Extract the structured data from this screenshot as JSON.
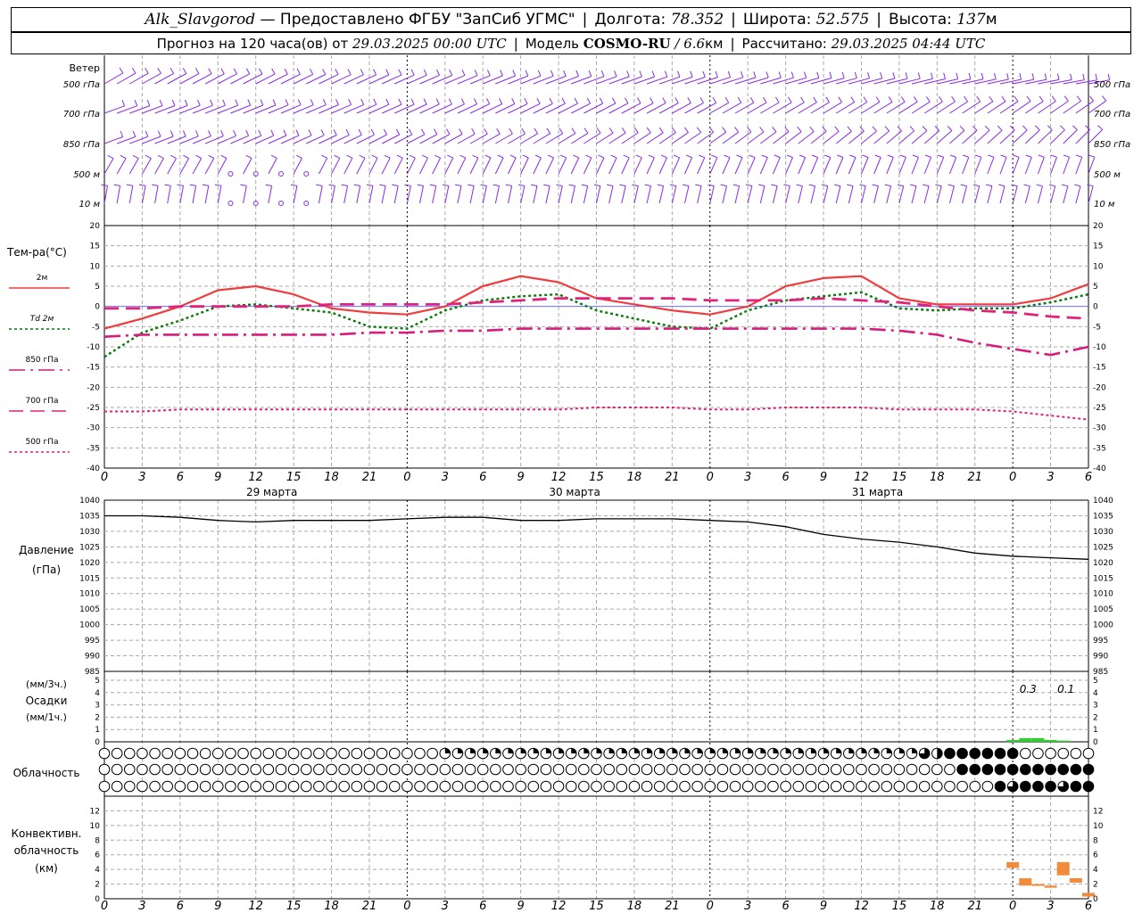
{
  "header": {
    "station": "Alk_Slavgorod",
    "dash": "—",
    "provider": "Предоставлено ФГБУ \"ЗапСиб УГМС\"",
    "lon_label": "Долгота:",
    "lon_value": "78.352",
    "lat_label": "Широта:",
    "lat_value": "52.575",
    "alt_label": "Высота:",
    "alt_value": "137",
    "alt_unit": "м"
  },
  "subheader": {
    "forecast_prefix": "Прогноз на 120 часа(ов) от",
    "forecast_from": "29.03.2025 00:00 UTC",
    "model_label": "Модель",
    "model_name": "COSMO-RU",
    "model_res": "/ 6.6",
    "model_res_unit": "км",
    "computed_label": "Рассчитано:",
    "computed_value": "29.03.2025 04:44 UTC"
  },
  "wind_panel": {
    "title": "Ветер",
    "levels_left": [
      "500 гПа",
      "700 гПа",
      "850 гПа",
      "500 м",
      "10  м"
    ],
    "levels_right": [
      "500 гПа",
      "700 гПа",
      "850 гПа",
      "500 м",
      "10  м"
    ],
    "color": "#8a2be2"
  },
  "temp_panel": {
    "title": "Тем-ра(°С)",
    "legend": [
      {
        "label": "2м",
        "color": "#f03c3c",
        "dash": ""
      },
      {
        "label": "Td  2м",
        "color": "#0a7a0a",
        "dash": "3,3"
      },
      {
        "label": "850 гПа",
        "color": "#d61c7c",
        "dash": "18,6,3,6"
      },
      {
        "label": "700 гПа",
        "color": "#e0227a",
        "dash": "16,8"
      },
      {
        "label": "500 гПа",
        "color": "#e0227a",
        "dash": "3,3"
      }
    ]
  },
  "pressure_panel": {
    "title": "Давление",
    "unit": "(гПа)"
  },
  "precip_panel": {
    "unit1": "(мм/3ч.)",
    "title": "Осадки",
    "unit2": "(мм/1ч.)",
    "labels": [
      "0.3",
      "0.1"
    ]
  },
  "cloud_panel": {
    "title": "Облачность"
  },
  "conv_panel": {
    "title1": "Конвективн.",
    "title2": "облачность",
    "unit": "(км)"
  },
  "time_axis": {
    "ticks": [
      "0",
      "3",
      "6",
      "9",
      "12",
      "15",
      "18",
      "21",
      "0",
      "3",
      "6",
      "9",
      "12",
      "15",
      "18",
      "21",
      "0",
      "3",
      "6",
      "9",
      "12",
      "15",
      "18",
      "21",
      "0",
      "3",
      "6"
    ],
    "dates": [
      "29 марта",
      "30 марта",
      "31 марта"
    ]
  },
  "chart_data": [
    {
      "type": "line",
      "name": "temperature",
      "ylabel": "Тем-ра(°С)",
      "ylim": [
        -40,
        20
      ],
      "yticks": [
        20,
        15,
        10,
        5,
        0,
        -5,
        -10,
        -15,
        -20,
        -25,
        -30,
        -35,
        -40
      ],
      "x_hours": [
        0,
        3,
        6,
        9,
        12,
        15,
        18,
        21,
        24,
        27,
        30,
        33,
        36,
        39,
        42,
        45,
        48,
        51,
        54,
        57,
        60,
        63,
        66,
        69,
        72,
        75,
        78
      ],
      "series": [
        {
          "name": "2м",
          "color": "#f03c3c",
          "values": [
            -5.5,
            -3,
            0,
            4,
            5,
            3,
            -0.5,
            -1.5,
            -2,
            0,
            5,
            7.5,
            6,
            2,
            0.5,
            -1,
            -2,
            0,
            5,
            7,
            7.5,
            2,
            0.5,
            0.5,
            0.5,
            2,
            5.5
          ]
        },
        {
          "name": "Td 2м",
          "color": "#0a7a0a",
          "values": [
            -12.5,
            -6.5,
            -3.5,
            0,
            0.5,
            -0.5,
            -1.5,
            -5,
            -5.5,
            -1,
            1.5,
            2.5,
            3,
            -1,
            -3,
            -5,
            -5.5,
            -1,
            1.5,
            2.5,
            3.5,
            -0.5,
            -1,
            -0.5,
            -0.5,
            1,
            3
          ]
        },
        {
          "name": "850 гПа",
          "color": "#d61c7c",
          "values": [
            -7.5,
            -7,
            -7,
            -7,
            -7,
            -7,
            -7,
            -6.5,
            -6.5,
            -6,
            -6,
            -5.5,
            -5.5,
            -5.5,
            -5.5,
            -5.5,
            -5.5,
            -5.5,
            -5.5,
            -5.5,
            -5.5,
            -6,
            -7,
            -9,
            -10.5,
            -12,
            -10
          ]
        },
        {
          "name": "700 гПа",
          "color": "#e0227a",
          "values": [
            -0.5,
            -0.5,
            0,
            0,
            0,
            0,
            0.5,
            0.5,
            0.5,
            0.5,
            1,
            1.5,
            2,
            2,
            2,
            2,
            1.5,
            1.5,
            1.5,
            2,
            1.5,
            1,
            0,
            -1,
            -1.5,
            -2.5,
            -3
          ]
        },
        {
          "name": "500 гПа",
          "color": "#e0227a",
          "values": [
            -26,
            -26,
            -25.5,
            -25.5,
            -25.5,
            -25.5,
            -25.5,
            -25.5,
            -25.5,
            -25.5,
            -25.5,
            -25.5,
            -25.5,
            -25,
            -25,
            -25,
            -25.5,
            -25.5,
            -25,
            -25,
            -25,
            -25.5,
            -25.5,
            -25.5,
            -26,
            -27,
            -28
          ]
        }
      ]
    },
    {
      "type": "line",
      "name": "pressure",
      "ylabel": "Давление",
      "ylim": [
        985,
        1040
      ],
      "yticks": [
        1040,
        1035,
        1030,
        1025,
        1020,
        1015,
        1010,
        1005,
        1000,
        995,
        990,
        985
      ],
      "x_hours": [
        0,
        3,
        6,
        9,
        12,
        15,
        18,
        21,
        24,
        27,
        30,
        33,
        36,
        39,
        42,
        45,
        48,
        51,
        54,
        57,
        60,
        63,
        66,
        69,
        72,
        75,
        78
      ],
      "series": [
        {
          "name": "pressure",
          "color": "#000000",
          "values": [
            1035,
            1035,
            1034.5,
            1033.5,
            1033,
            1033.5,
            1033.5,
            1033.5,
            1034,
            1034.5,
            1034.5,
            1033.5,
            1033.5,
            1034,
            1034,
            1034,
            1033.5,
            1033,
            1031.5,
            1029,
            1027.5,
            1026.5,
            1025,
            1023,
            1022,
            1021.5,
            1021
          ]
        }
      ]
    },
    {
      "type": "bar",
      "name": "precipitation",
      "ylim": [
        0,
        5
      ],
      "yticks": [
        5,
        4,
        3,
        2,
        1,
        0
      ],
      "bars": [
        {
          "x": 72,
          "value": 0.15
        },
        {
          "x": 73,
          "value": 0.3
        },
        {
          "x": 74,
          "value": 0.3
        },
        {
          "x": 75,
          "value": 0.15
        },
        {
          "x": 76,
          "value": 0.1
        }
      ],
      "labels": [
        {
          "x": 73,
          "text": "0.3"
        },
        {
          "x": 76,
          "text": "0.1"
        }
      ]
    },
    {
      "type": "bar",
      "name": "convective_cloud",
      "ylim": [
        0,
        14
      ],
      "yticks": [
        12,
        10,
        8,
        6,
        4,
        2,
        0
      ],
      "boxes": [
        {
          "x": 72,
          "base": 4.2,
          "top": 5
        },
        {
          "x": 73,
          "base": 1.8,
          "top": 2.8
        },
        {
          "x": 74,
          "base": 1.8,
          "top": 2
        },
        {
          "x": 75,
          "base": 1.5,
          "top": 1.8
        },
        {
          "x": 76,
          "base": 3.2,
          "top": 5
        },
        {
          "x": 77,
          "base": 2.2,
          "top": 2.8
        },
        {
          "x": 78,
          "base": 0.3,
          "top": 0.8
        }
      ]
    },
    {
      "type": "table",
      "name": "cloudiness",
      "rows": [
        "upper",
        "middle",
        "lower"
      ],
      "hourly_coverage_0_to_4": {
        "upper": [
          [
            0,
            0
          ],
          [
            27,
            1
          ],
          [
            64,
            1
          ],
          [
            65,
            3
          ],
          [
            66,
            2
          ],
          [
            67,
            4
          ],
          [
            73,
            0
          ]
        ],
        "middle": [
          [
            0,
            0
          ],
          [
            68,
            4
          ]
        ],
        "lower": [
          [
            0,
            0
          ],
          [
            71,
            4
          ],
          [
            72,
            3
          ],
          [
            73,
            4
          ],
          [
            76,
            3
          ],
          [
            77,
            4
          ]
        ]
      }
    }
  ]
}
